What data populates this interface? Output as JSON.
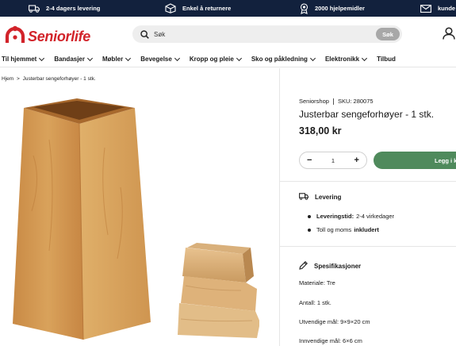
{
  "topbar": {
    "delivery": "2-4 dagers levering",
    "returns": "Enkel å returnere",
    "aids": "2000 hjelpemidler",
    "contact": "kunde"
  },
  "header": {
    "logo_text": "Seniorlife",
    "search_placeholder": "Søk",
    "search_button": "Søk"
  },
  "nav": [
    {
      "label": "Til hjemmet"
    },
    {
      "label": "Bandasjer"
    },
    {
      "label": "Møbler"
    },
    {
      "label": "Bevegelse"
    },
    {
      "label": "Kropp og pleie"
    },
    {
      "label": "Sko og påkledning"
    },
    {
      "label": "Elektronikk"
    },
    {
      "label": "Tilbud"
    }
  ],
  "breadcrumb": {
    "home": "Hjem",
    "sep": ">",
    "current": "Justerbar sengeforhøyer - 1 stk."
  },
  "product": {
    "vendor": "Seniorshop",
    "sku": "SKU: 280075",
    "title": "Justerbar sengeforhøyer - 1 stk.",
    "price": "318,00 kr",
    "quantity": "1",
    "minus": "−",
    "plus": "+",
    "add_to_cart": "Legg i k"
  },
  "delivery": {
    "heading": "Levering",
    "time_label": "Leveringstid:",
    "time_value": "2-4 virkedager",
    "duty_prefix": "Toll og moms",
    "duty_bold": "inkludert"
  },
  "specs": {
    "heading": "Spesifikasjoner",
    "material": "Materiale: Tre",
    "count": "Antall: 1 stk.",
    "outer": "Utvendige mål: 9×9×20 cm",
    "inner": "Innvendige mål: 6×6 cm"
  },
  "colors": {
    "topbar": "#12213d",
    "brand": "#d2232a",
    "cart": "#4f8a5c"
  }
}
